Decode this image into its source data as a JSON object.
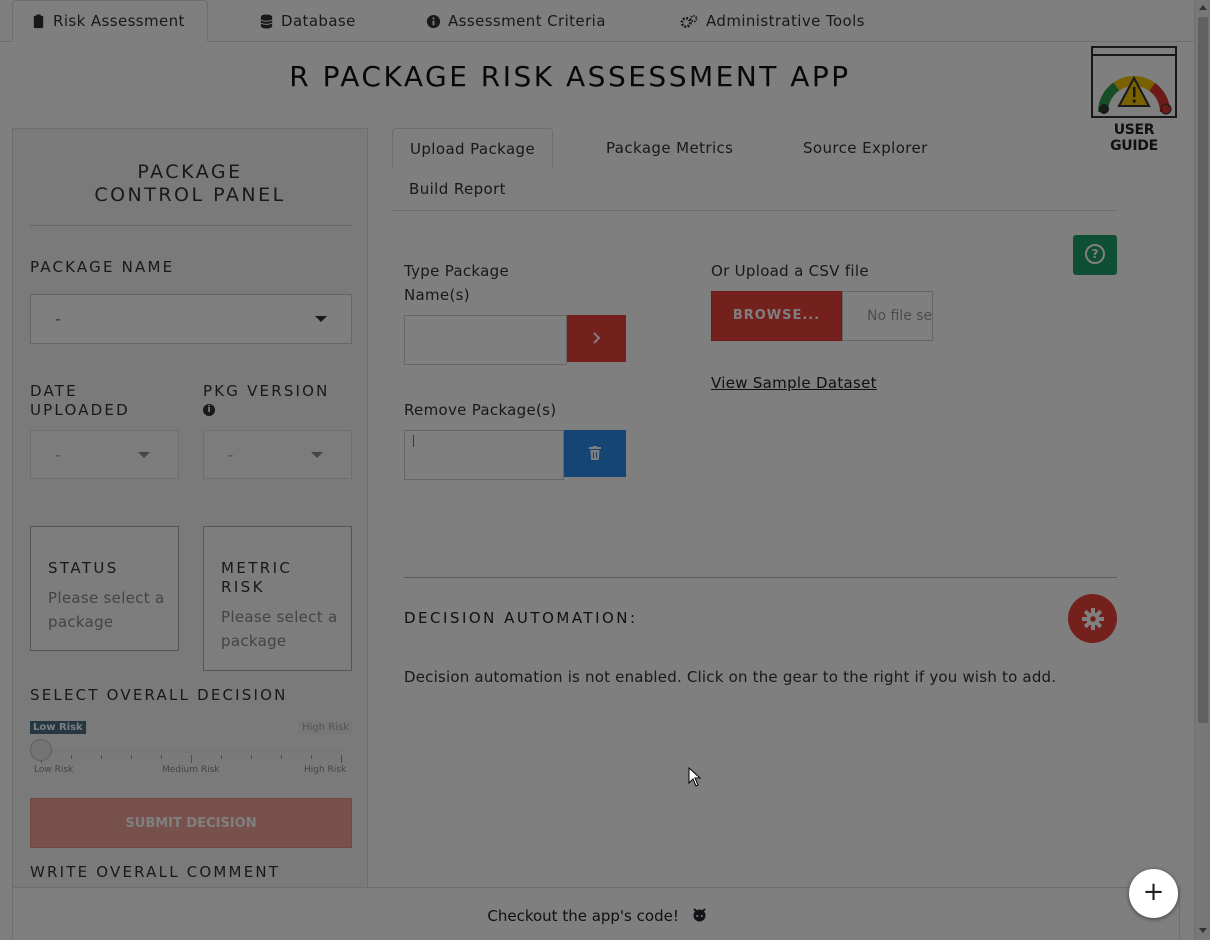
{
  "nav": {
    "tabs": [
      {
        "label": "Risk Assessment",
        "icon": "clipboard-icon",
        "active": true
      },
      {
        "label": "Database",
        "icon": "database-icon",
        "active": false
      },
      {
        "label": "Assessment Criteria",
        "icon": "info-circle-icon",
        "active": false
      },
      {
        "label": "Administrative Tools",
        "icon": "gears-icon",
        "active": false
      }
    ]
  },
  "app_title": "R PACKAGE RISK ASSESSMENT APP",
  "user_guide": {
    "label": "USER GUIDE"
  },
  "sidebar": {
    "title": "PACKAGE CONTROL PANEL",
    "package_name_label": "PACKAGE NAME",
    "package_name_value": "-",
    "date_uploaded_label": "DATE UPLOADED",
    "date_uploaded_value": "-",
    "pkg_version_label": "PKG VERSION",
    "pkg_version_value": "-",
    "status_card": {
      "title": "STATUS",
      "value": "Please select a package"
    },
    "metric_risk_card": {
      "title": "METRIC RISK",
      "value": "Please select a package"
    },
    "overall_decision_label": "SELECT OVERALL DECISION",
    "slider": {
      "min_badge": "Low Risk",
      "max_badge": "High Risk",
      "ticks": [
        "Low Risk",
        "Medium Risk",
        "High Risk"
      ],
      "position": 0
    },
    "submit_label": "SUBMIT DECISION",
    "comment_label": "WRITE OVERALL COMMENT"
  },
  "main": {
    "tabs": [
      {
        "label": "Upload Package",
        "active": true
      },
      {
        "label": "Package Metrics",
        "active": false
      },
      {
        "label": "Source Explorer",
        "active": false
      },
      {
        "label": "Build Report",
        "active": false
      }
    ],
    "type_package_label": "Type Package Name(s)",
    "type_package_value": "",
    "remove_package_label": "Remove Package(s)",
    "upload_csv_label": "Or Upload a CSV file",
    "browse_label": "BROWSE...",
    "no_file_label": "No file selected.",
    "sample_link": "View Sample Dataset",
    "decision_automation_title": "DECISION AUTOMATION:",
    "decision_automation_text": "Decision automation is not enabled. Click on the gear to the right if you wish to add."
  },
  "footer": {
    "text": "Checkout the app's code!",
    "icon": "github-icon"
  },
  "fab_label": "+",
  "colors": {
    "accent_red": "#e9423a",
    "accent_blue": "#2b8ae8",
    "help_green": "#1f9e6b",
    "overlay": "rgba(0,0,0,0.5)"
  }
}
